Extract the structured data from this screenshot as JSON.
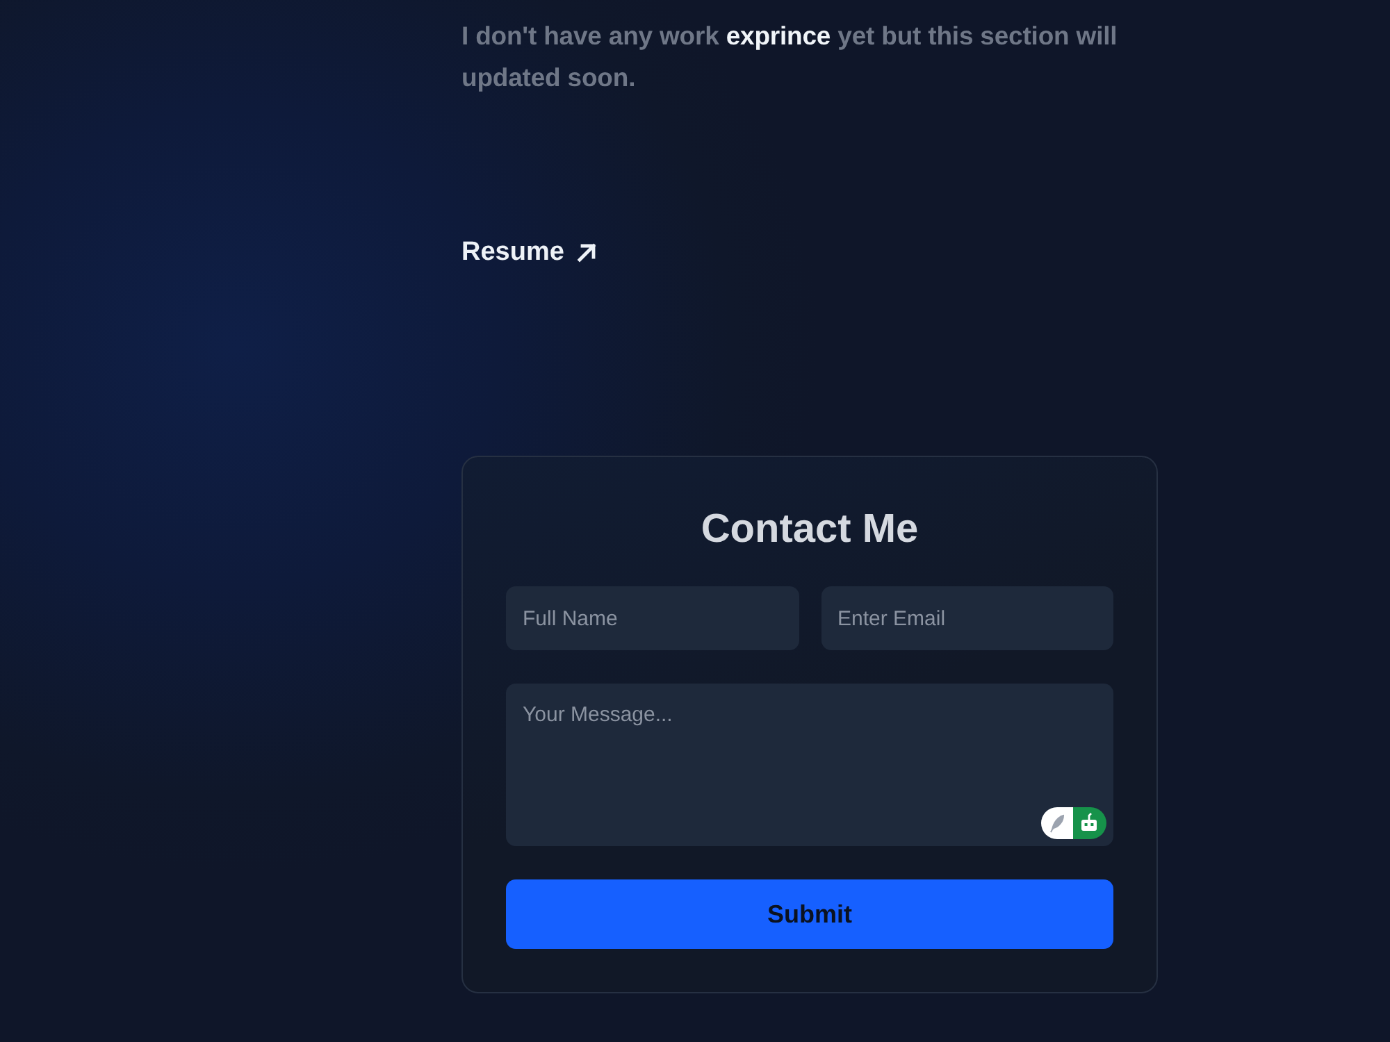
{
  "about": {
    "text": "I don't have any work **exprince** yet but this section will updated soon."
  },
  "resume_link": {
    "label": "Resume"
  },
  "contact_form": {
    "title": "Contact Me",
    "fields": [
      {
        "placeholder": "Full Name"
      },
      {
        "placeholder": "Enter Email"
      }
    ],
    "message": {
      "placeholder": "Your Message..."
    },
    "submit": {
      "label": "Submit"
    }
  }
}
